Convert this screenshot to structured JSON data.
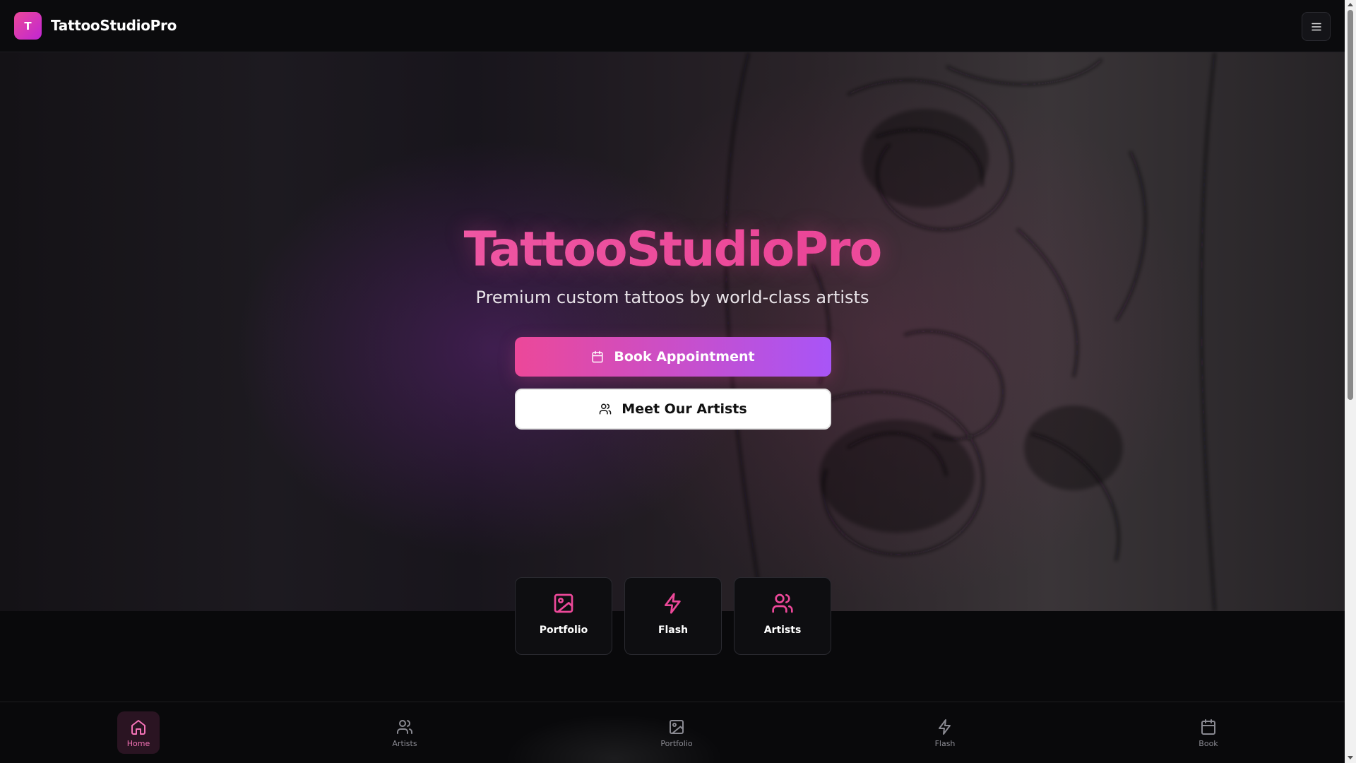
{
  "header": {
    "logo_letter": "T",
    "brand": "TattooStudioPro",
    "menu_icon": "menu-icon"
  },
  "hero": {
    "title": "TattooStudioPro",
    "subtitle": "Premium custom tattoos by world-class artists",
    "primary_button": {
      "label": "Book Appointment",
      "icon": "calendar-icon"
    },
    "secondary_button": {
      "label": "Meet Our Artists",
      "icon": "users-icon"
    }
  },
  "quick_links": [
    {
      "label": "Portfolio",
      "icon": "image-icon"
    },
    {
      "label": "Flash",
      "icon": "lightning-icon"
    },
    {
      "label": "Artists",
      "icon": "users-icon"
    }
  ],
  "bottom_nav": {
    "active": "Home",
    "items": [
      {
        "label": "Home",
        "icon": "home-icon"
      },
      {
        "label": "Artists",
        "icon": "users-icon"
      },
      {
        "label": "Portfolio",
        "icon": "image-icon"
      },
      {
        "label": "Flash",
        "icon": "lightning-icon"
      },
      {
        "label": "Book",
        "icon": "calendar-icon"
      }
    ]
  },
  "colors": {
    "accent": "#ec4899",
    "accent_secondary": "#a855f7",
    "background": "#09090b"
  }
}
